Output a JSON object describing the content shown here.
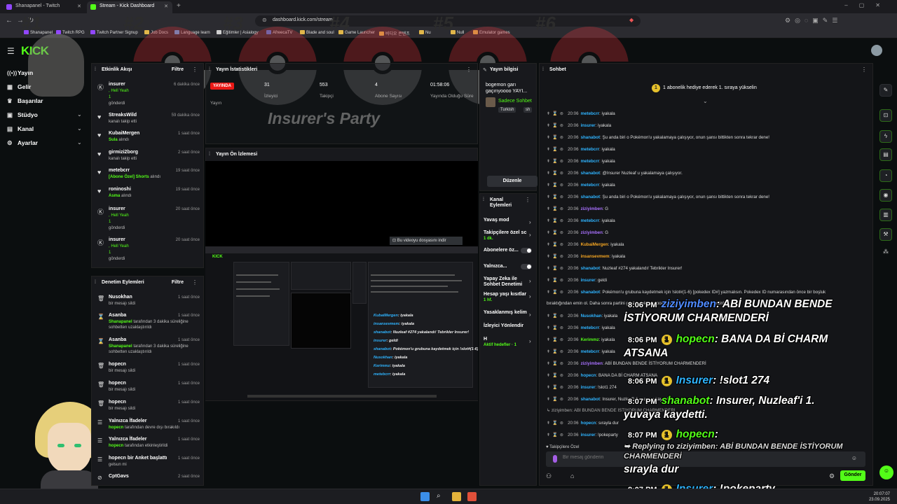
{
  "browser": {
    "tabs": [
      {
        "label": "Shanapanel - Twitch",
        "color": "#9147ff"
      },
      {
        "label": "Stream - Kick Dashboard",
        "color": "#53fc18"
      }
    ],
    "url": "dashboard.kick.com/stream",
    "bookmarks": [
      "Shanapanel",
      "Twitch RPG",
      "Twitch Partner Signup",
      "Job Docs",
      "Language learn",
      "Eğitimler | Asialogy",
      "AfreecaTV",
      "Blade and soul",
      "Game Launcher",
      "비디오 콘텐츠",
      "Nu",
      "Null",
      "Emulator games"
    ]
  },
  "overlay_numbers": [
    "#1",
    "#2",
    "#3",
    "#4",
    "#5",
    "#6"
  ],
  "sidebar": {
    "items": [
      {
        "label": "Yayın",
        "icon": "broadcast-icon"
      },
      {
        "label": "Gelir",
        "icon": "money-icon"
      },
      {
        "label": "Başarılar",
        "icon": "trophy-icon"
      },
      {
        "label": "Stüdyo",
        "icon": "studio-icon"
      },
      {
        "label": "Kanal",
        "icon": "channel-icon"
      },
      {
        "label": "Ayarlar",
        "icon": "gear-icon"
      }
    ]
  },
  "activity": {
    "title": "Etkinlik Akışı",
    "filter": "Filtre",
    "events": [
      {
        "user": "insurer",
        "line1": ", Hell Yeah",
        "line2": "1",
        "line3": "gönderdi",
        "time": "6 dakika önce"
      },
      {
        "user": "StreaksWild",
        "line1": "kanalı takip etti",
        "time": "59 dakika önce"
      },
      {
        "user": "KubaiMergen",
        "line1": "Sula",
        "line1b": " alındı",
        "time": "1 saat önce"
      },
      {
        "user": "girmizi2borg",
        "line1": "kanalı takip etti",
        "time": "2 saat önce"
      },
      {
        "user": "metebcrr",
        "line1": "[Abone Özel] Shorts",
        "line1b": " alındı",
        "time": "19 saat önce"
      },
      {
        "user": "roninoshi",
        "line1": "Asma",
        "line1b": " alındı",
        "time": "19 saat önce"
      },
      {
        "user": "insurer",
        "line1": ", Hell Yeah",
        "line2": "1",
        "line3": "gönderdi",
        "time": "20 saat önce"
      },
      {
        "user": "insurer",
        "line1": ", Hell Yeah",
        "line2": "1",
        "line3": "gönderdi",
        "time": "20 saat önce"
      }
    ]
  },
  "moderation": {
    "title": "Denetim Eylemleri",
    "filter": "Filtre",
    "events": [
      {
        "user": "Nusokhan",
        "line1": "bir mesajı sildi",
        "time": "1 saat önce"
      },
      {
        "user": "Asanba",
        "line1": "Shanapanel",
        "line1b": " tarafından 3 dakika süreliğine",
        "line2": "sohbetten uzaklaştırıldı",
        "time": "1 saat önce"
      },
      {
        "user": "Asanba",
        "line1": "Shanapanel",
        "line1b": " tarafından 3 dakika süreliğine",
        "line2": "sohbetten uzaklaştırıldı",
        "time": "1 saat önce"
      },
      {
        "user": "hopecn",
        "line1": "bir mesajı sildi",
        "time": "1 saat önce"
      },
      {
        "user": "hopecn",
        "line1": "bir mesajı sildi",
        "time": "1 saat önce"
      },
      {
        "user": "hopecn",
        "line1": "bir mesajı sildi",
        "time": "1 saat önce"
      },
      {
        "user": "Yalnızca İfadeler",
        "line1": "hopecn",
        "line1b": " tarafından devre dışı bırakıldı",
        "time": "1 saat önce"
      },
      {
        "user": "Yalnızca İfadeler",
        "line1": "hopecn",
        "line1b": " tarafından etkinleştirildi",
        "time": "1 saat önce"
      },
      {
        "user": "hopecn bir Anket başlattı",
        "line1": "gelsun mi",
        "time": "1 saat önce"
      },
      {
        "user": "CptGavs",
        "line1": "",
        "time": "2 saat önce"
      }
    ]
  },
  "stats": {
    "title": "Yayın İstatistikleri",
    "live": "YAYINDA",
    "items": [
      {
        "value": "",
        "label": "Yayın"
      },
      {
        "value": "31",
        "label": "İzleyici"
      },
      {
        "value": "553",
        "label": "Takipçi"
      },
      {
        "value": "4",
        "label": "Abone Sayısı"
      },
      {
        "value": "01:58:06",
        "label": "Yayında Olduğu Süre"
      }
    ]
  },
  "party_title": "Insurer's Party",
  "preview": {
    "title": "Yayın Ön İzlemesi",
    "download": "Bu videoyu dosyasını indir",
    "mini_chat": [
      {
        "user": "KubaiMergen",
        "text": ": iyakala"
      },
      {
        "user": "insansevmem",
        "text": ": iyakala"
      },
      {
        "user": "shanabot",
        "text": ": Nuzleaf #274 yakalandı! Tebrikler Insurer!"
      },
      {
        "user": "insurer",
        "text": ": geldi"
      },
      {
        "user": "shanabot",
        "text": ": Pokémon'u grubuna kaydetmek için !slot#(1-6) [pokedex ID#]"
      },
      {
        "user": "Nusokhan",
        "text": ": iyakala"
      },
      {
        "user": "Kerimmz",
        "text": ": iyakala"
      },
      {
        "user": "metebcrr",
        "text": ": iyakala"
      }
    ]
  },
  "stream_info": {
    "title": "Yayın bilgisi",
    "stream_title": "bogemon garı gaçırıyoooo YAYI...",
    "category": "Sadece Sohbet",
    "tags": [
      "Turkish",
      "sh"
    ],
    "edit": "Düzenle"
  },
  "channel_actions": {
    "title": "Kanal Eylemleri",
    "items": [
      {
        "label": "Yavaş mod",
        "sub": "",
        "control": "chevron"
      },
      {
        "label": "Takipçilere özel sc",
        "sub": "1 dk.",
        "control": "chevron"
      },
      {
        "label": "Abonelere öz...",
        "sub": "",
        "control": "toggle"
      },
      {
        "label": "Yalnızca...",
        "sub": "",
        "control": "toggle"
      },
      {
        "label": "Yapay Zeka ile Sohbet Denetimi",
        "sub": "",
        "control": "chevron"
      },
      {
        "label": "Hesap yaşı kısıtlar",
        "sub": "1 hf.",
        "control": "chevron"
      },
      {
        "label": "Yasaklanmış kelim",
        "sub": "",
        "control": "chevron"
      },
      {
        "label": "İzleyici Yönlendir",
        "sub": "",
        "control": "none"
      },
      {
        "label": "H",
        "sub": "Aktif hedefler · 1",
        "control": "chevron"
      }
    ]
  },
  "chat": {
    "title": "Sohbet",
    "gift_badge": "1",
    "gift_text": "1 abonelik hediye ederek 1. sıraya yükselin",
    "messages": [
      {
        "time": "20:06",
        "user": "metebcrr",
        "color": "#2fb4ff",
        "text": ": iyakala"
      },
      {
        "time": "20:06",
        "user": "insurer",
        "color": "#2fb4ff",
        "text": ": iyakala"
      },
      {
        "time": "20:06",
        "user": "shanabot",
        "color": "#2fb4ff",
        "text": ": Şu anda biri o Pokémon'u yakalamaya çalışıyor, onun şansı bittikten sonra tekrar dene!"
      },
      {
        "time": "20:06",
        "user": "metebcrr",
        "color": "#2fb4ff",
        "text": ": iyakala"
      },
      {
        "time": "20:06",
        "user": "metebcrr",
        "color": "#2fb4ff",
        "text": ": iyakala"
      },
      {
        "time": "20:06",
        "user": "shanabot",
        "color": "#2fb4ff",
        "text": ": @Insurer Nuzleaf u yakalamaya çalışıyor."
      },
      {
        "time": "20:06",
        "user": "metebcrr",
        "color": "#2fb4ff",
        "text": ": iyakala"
      },
      {
        "time": "20:06",
        "user": "shanabot",
        "color": "#2fb4ff",
        "text": ": Şu anda biri o Pokémon'u yakalamaya çalışıyor, onun şansı bittikten sonra tekrar dene!"
      },
      {
        "time": "20:06",
        "user": "ziziyimben",
        "color": "#a970ff",
        "text": ": G"
      },
      {
        "time": "20:06",
        "user": "metebcrr",
        "color": "#2fb4ff",
        "text": ": iyakala"
      },
      {
        "time": "20:06",
        "user": "ziziyimben",
        "color": "#a970ff",
        "text": ": G"
      },
      {
        "time": "20:06",
        "user": "KubaiMergen",
        "color": "#f5a623",
        "text": ": iyakala"
      },
      {
        "time": "20:06",
        "user": "insansevmem",
        "color": "#f5a623",
        "text": ": iyakala"
      },
      {
        "time": "20:06",
        "user": "shanabot",
        "color": "#2fb4ff",
        "text": ": Nuzleaf #274 yakalandı! Tebrikler Insurer!"
      },
      {
        "time": "20:06",
        "user": "insurer",
        "color": "#2fb4ff",
        "text": ": geldi"
      },
      {
        "time": "20:06",
        "user": "shanabot",
        "color": "#2fb4ff",
        "text": ": Pokémon'u grubuna kaydetmek için !slot#(1-6) [pokedex ID#] yazmalısın. Pokedex ID numarasından önce bir boşluk"
      },
      {
        "time": "",
        "user": "",
        "color": "#ddd",
        "text": "bıraktığından emin ol. Daha sonra partini göstermek için !pokeparty komutunu kullanabilirsin!"
      },
      {
        "time": "20:06",
        "user": "Nusokhan",
        "color": "#2fb4ff",
        "text": ": iyakala"
      },
      {
        "time": "20:06",
        "user": "metebcrr",
        "color": "#2fb4ff",
        "text": ": iyakala"
      },
      {
        "time": "20:06",
        "user": "Kerimmz",
        "color": "#53fc18",
        "text": ": iyakala"
      },
      {
        "time": "20:06",
        "user": "metebcrr",
        "color": "#2fb4ff",
        "text": ": iyakala"
      },
      {
        "time": "20:06",
        "user": "ziziyimben",
        "color": "#a970ff",
        "text": ": ABİ BUNDAN BENDE İSTİYORUM CHARMENDERİ"
      },
      {
        "time": "20:06",
        "user": "hopecn",
        "color": "#2fb4ff",
        "text": ": BANA DA Bİ CHARM ATSANA"
      },
      {
        "time": "20:06",
        "user": "insurer",
        "color": "#2fb4ff",
        "text": ": !slot1 274"
      },
      {
        "time": "20:06",
        "user": "shanabot",
        "color": "#2fb4ff",
        "text": ": Insurer, Nuzleaf'i 1. yuvaya kaydetti."
      },
      {
        "time": "",
        "user": "",
        "color": "#aaa",
        "text": "↳ ziziyimben: ABİ BUNDAN BENDE İSTİYORUM CHARMENDERİ"
      },
      {
        "time": "20:06",
        "user": "hopecn",
        "color": "#2fb4ff",
        "text": ": sırayla dur"
      },
      {
        "time": "20:06",
        "user": "insurer",
        "color": "#2fb4ff",
        "text": ": !pokeparty"
      }
    ],
    "followers_only": "Takipçilere Özel",
    "input_placeholder": "Bir mesaj gönderin",
    "send": "Gönder"
  },
  "overlay_chat": [
    {
      "time": "8:06 PM",
      "user": "ziziyimben",
      "color": "#4f8bff",
      "text": ": ABİ BUNDAN BENDE",
      "cont": "İSTİYORUM CHARMENDERİ",
      "coin": ""
    },
    {
      "time": "8:06 PM",
      "user": "hopecn",
      "color": "#53fc18",
      "text": ": BANA DA Bİ CHARM",
      "cont": "ATSANA",
      "coin": "1"
    },
    {
      "time": "8:06 PM",
      "user": "Insurer",
      "color": "#2fb4ff",
      "text": ": !slot1 274",
      "cont": "",
      "coin": "1"
    },
    {
      "time": "8:07 PM",
      "user": "shanabot",
      "color": "#53fc18",
      "text": ": Insurer, Nuzleaf'i 1.",
      "cont": "yuvaya kaydetti.",
      "coin": ""
    },
    {
      "time": "8:07 PM",
      "user": "hopecn",
      "color": "#53fc18",
      "text": ":",
      "cont": "",
      "coin": "1"
    },
    {
      "time": "8:07 PM",
      "user": "Insurer",
      "color": "#2fb4ff",
      "text": ": !pokeparty",
      "cont": "",
      "coin": "1"
    }
  ],
  "overlay_reply": {
    "line1": "Replying to ziziyimben: ABİ BUNDAN BENDE İSTİYORUM",
    "line2": "CHARMENDERİ",
    "line3": "sırayla dur"
  },
  "taskbar": {
    "time": "20:07:07",
    "date": "23.09.2025"
  }
}
